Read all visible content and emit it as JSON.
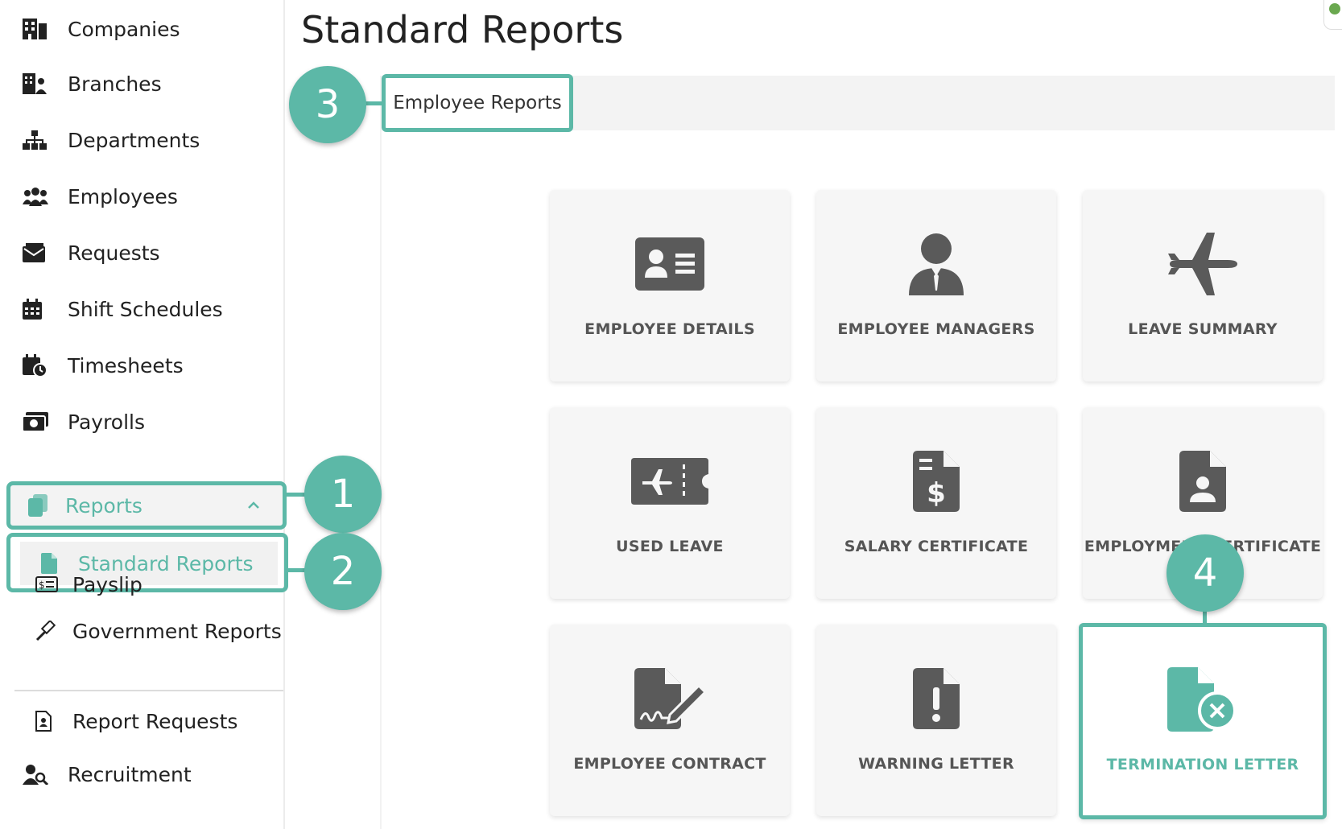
{
  "header": {
    "title": "Standard Reports"
  },
  "sidebar": {
    "items": [
      {
        "label": "Companies",
        "icon": "building-icon"
      },
      {
        "label": "Branches",
        "icon": "city-icon"
      },
      {
        "label": "Departments",
        "icon": "sitemap-icon"
      },
      {
        "label": "Employees",
        "icon": "users-icon"
      },
      {
        "label": "Requests",
        "icon": "mail-icon"
      },
      {
        "label": "Shift Schedules",
        "icon": "calendar-icon"
      },
      {
        "label": "Timesheets",
        "icon": "calendar-clock-icon"
      },
      {
        "label": "Payrolls",
        "icon": "money-icon"
      }
    ],
    "reports": {
      "label": "Reports",
      "icon": "copy-icon",
      "expanded": true
    },
    "sub_items": [
      {
        "label": "Standard Reports",
        "icon": "file-icon",
        "active": true
      },
      {
        "label": "Payslip",
        "icon": "payslip-icon"
      },
      {
        "label": "Government Reports",
        "icon": "gavel-icon"
      }
    ],
    "bottom_items": [
      {
        "label": "Report Requests",
        "icon": "file-user-icon"
      },
      {
        "label": "Recruitment",
        "icon": "user-search-icon"
      }
    ]
  },
  "tabs": [
    {
      "label": "Employee Reports",
      "active": true
    }
  ],
  "cards": [
    {
      "label": "EMPLOYEE DETAILS",
      "icon": "id-card-icon"
    },
    {
      "label": "EMPLOYEE MANAGERS",
      "icon": "user-tie-icon"
    },
    {
      "label": "LEAVE SUMMARY",
      "icon": "plane-icon"
    },
    {
      "label": "USED LEAVE",
      "icon": "ticket-plane-icon"
    },
    {
      "label": "SALARY CERTIFICATE",
      "icon": "file-dollar-icon"
    },
    {
      "label": "EMPLOYMENT CERTIFICATE",
      "icon": "file-user-icon"
    },
    {
      "label": "EMPLOYEE CONTRACT",
      "icon": "file-signature-icon"
    },
    {
      "label": "WARNING LETTER",
      "icon": "file-exclamation-icon"
    },
    {
      "label": "TERMINATION LETTER",
      "icon": "file-cancel-icon",
      "highlighted": true
    }
  ],
  "callouts": [
    "1",
    "2",
    "3",
    "4"
  ],
  "colors": {
    "accent": "#5cb8a7",
    "icon": "#5a5a5a",
    "card_bg": "#f6f6f6"
  }
}
